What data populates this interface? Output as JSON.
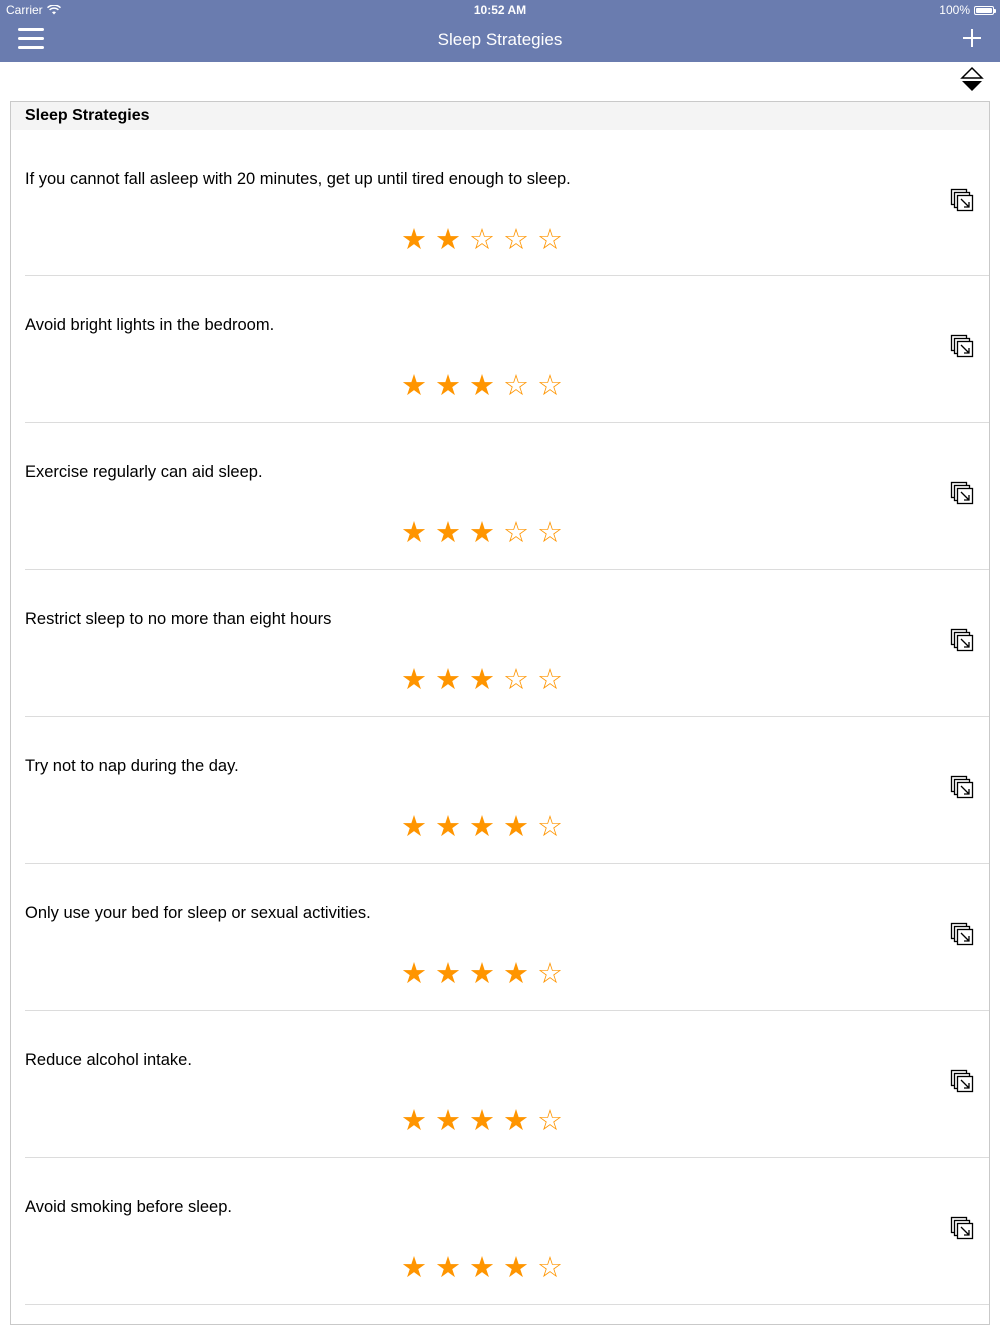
{
  "status_bar": {
    "carrier": "Carrier",
    "time": "10:52 AM",
    "battery": "100%"
  },
  "navbar": {
    "title": "Sleep Strategies",
    "menu_icon": "hamburger-menu-icon",
    "add_icon": "plus-icon",
    "sort_icon": "sort-toggle-icon"
  },
  "list": {
    "header": "Sleep Strategies",
    "star_color": "#ff9500",
    "items": [
      {
        "text": "If you cannot fall asleep with 20 minutes, get up until tired enough to sleep.",
        "rating": 2,
        "max_rating": 5
      },
      {
        "text": "Avoid bright lights in the bedroom.",
        "rating": 3,
        "max_rating": 5
      },
      {
        "text": "Exercise regularly can aid sleep.",
        "rating": 3,
        "max_rating": 5
      },
      {
        "text": "Restrict sleep to no more than eight hours",
        "rating": 3,
        "max_rating": 5
      },
      {
        "text": "Try not to nap during the day.",
        "rating": 4,
        "max_rating": 5
      },
      {
        "text": "Only use your bed for sleep or sexual activities.",
        "rating": 4,
        "max_rating": 5
      },
      {
        "text": "Reduce alcohol intake.",
        "rating": 4,
        "max_rating": 5
      },
      {
        "text": "Avoid smoking before sleep.",
        "rating": 4,
        "max_rating": 5
      }
    ]
  },
  "colors": {
    "navbar": "#6a7caf",
    "accent_star": "#ff9500"
  }
}
